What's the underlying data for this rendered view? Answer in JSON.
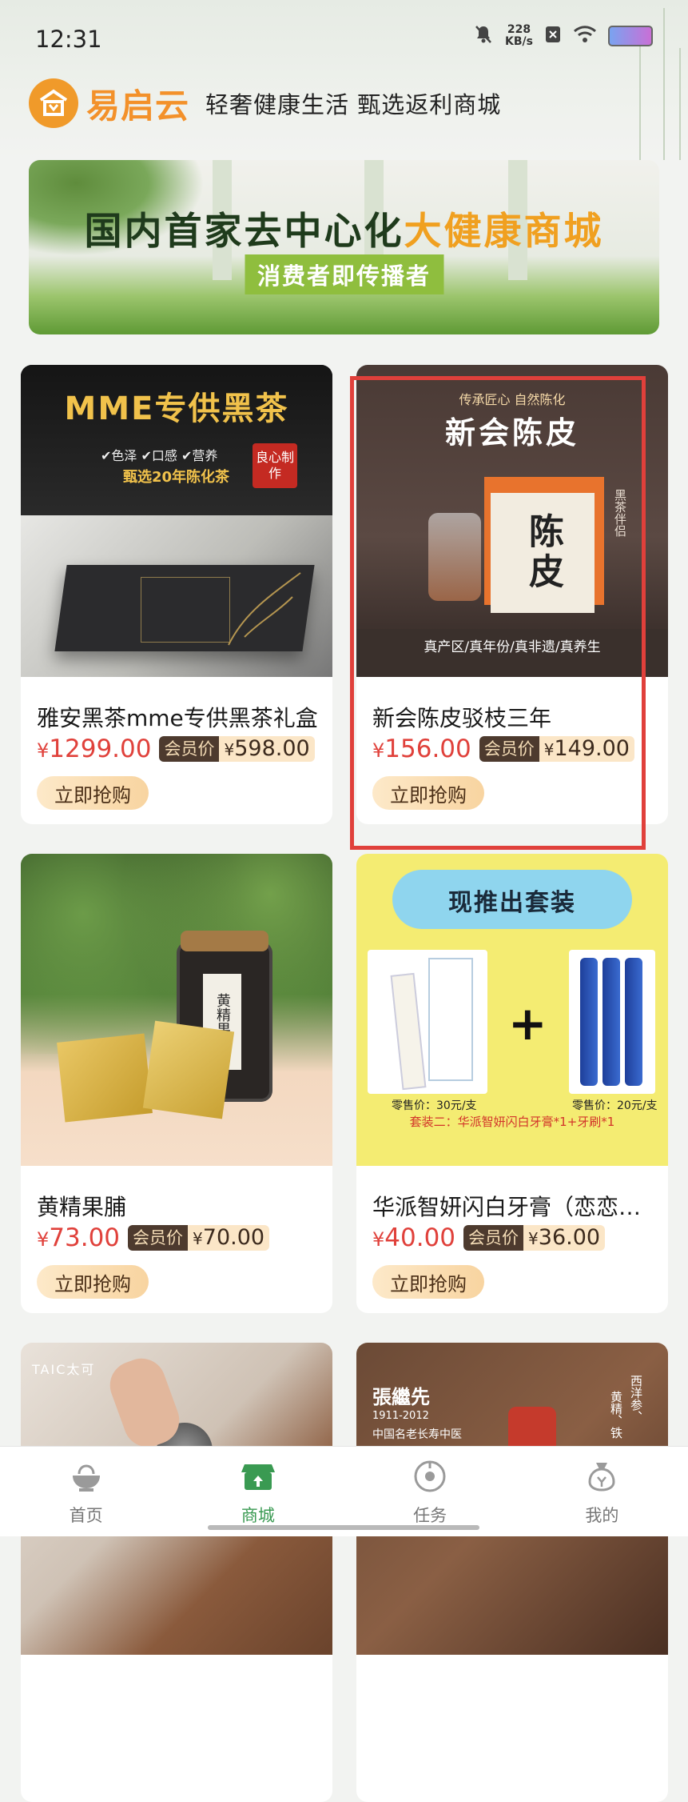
{
  "status_bar": {
    "time": "12:31",
    "net_speed_value": "228",
    "net_speed_unit": "KB/s"
  },
  "brand": {
    "name": "易启云",
    "slogan": "轻奢健康生活 甄选返利商城"
  },
  "banner": {
    "title_part1": "国内首家去中心化",
    "title_part2": "大健康商城",
    "subtitle": "消费者即传播者"
  },
  "products": [
    {
      "name": "雅安黑茶mme专供黑茶礼盒",
      "price": "1299.00",
      "member_label": "会员价",
      "member_price": "598.00",
      "buy_label": "立即抢购",
      "img_title": "MME专供黑茶",
      "img_checks": "✔色泽 ✔口感 ✔营养",
      "img_sub": "甄选20年陈化茶",
      "img_stamp": "良心制作"
    },
    {
      "name": "新会陈皮驳枝三年",
      "price": "156.00",
      "member_label": "会员价",
      "member_price": "149.00",
      "buy_label": "立即抢购",
      "img_top": "传承匠心 自然陈化",
      "img_title": "新会陈皮",
      "img_bottom": "真产区/真年份/真非遗/真养生",
      "img_box_text": "陈皮",
      "img_side": "黑茶伴侣"
    },
    {
      "name": "黄精果脯",
      "price": "73.00",
      "member_label": "会员价",
      "member_price": "70.00",
      "buy_label": "立即抢购",
      "img_jar_label": "黄精果脯"
    },
    {
      "name": "华派智妍闪白牙膏（恋恋…",
      "price": "40.00",
      "member_label": "会员价",
      "member_price": "36.00",
      "buy_label": "立即抢购",
      "img_title": "现推出套装",
      "img_price_left": "零售价：30元/支",
      "img_price_right": "零售价：20元/支",
      "img_combo": "套装二：华派智妍闪白牙膏*1+牙刷*1"
    },
    {
      "img_logo": "TAIC太可"
    },
    {
      "img_name": "張繼先",
      "img_years": "1911-2012",
      "img_line": "中国名老长寿中医",
      "img_side1": "西洋参、",
      "img_side2": "黄精、铁"
    }
  ],
  "currency": "¥",
  "nav": [
    {
      "label": "首页",
      "icon": "home-bowl-icon",
      "active": false
    },
    {
      "label": "商城",
      "icon": "store-icon",
      "active": true
    },
    {
      "label": "任务",
      "icon": "task-coin-icon",
      "active": false
    },
    {
      "label": "我的",
      "icon": "money-bag-icon",
      "active": false
    }
  ],
  "colors": {
    "accent_orange": "#f3912a",
    "price_red": "#e0413b",
    "active_nav_green": "#3a9a52",
    "highlight_red": "#e0403b"
  }
}
